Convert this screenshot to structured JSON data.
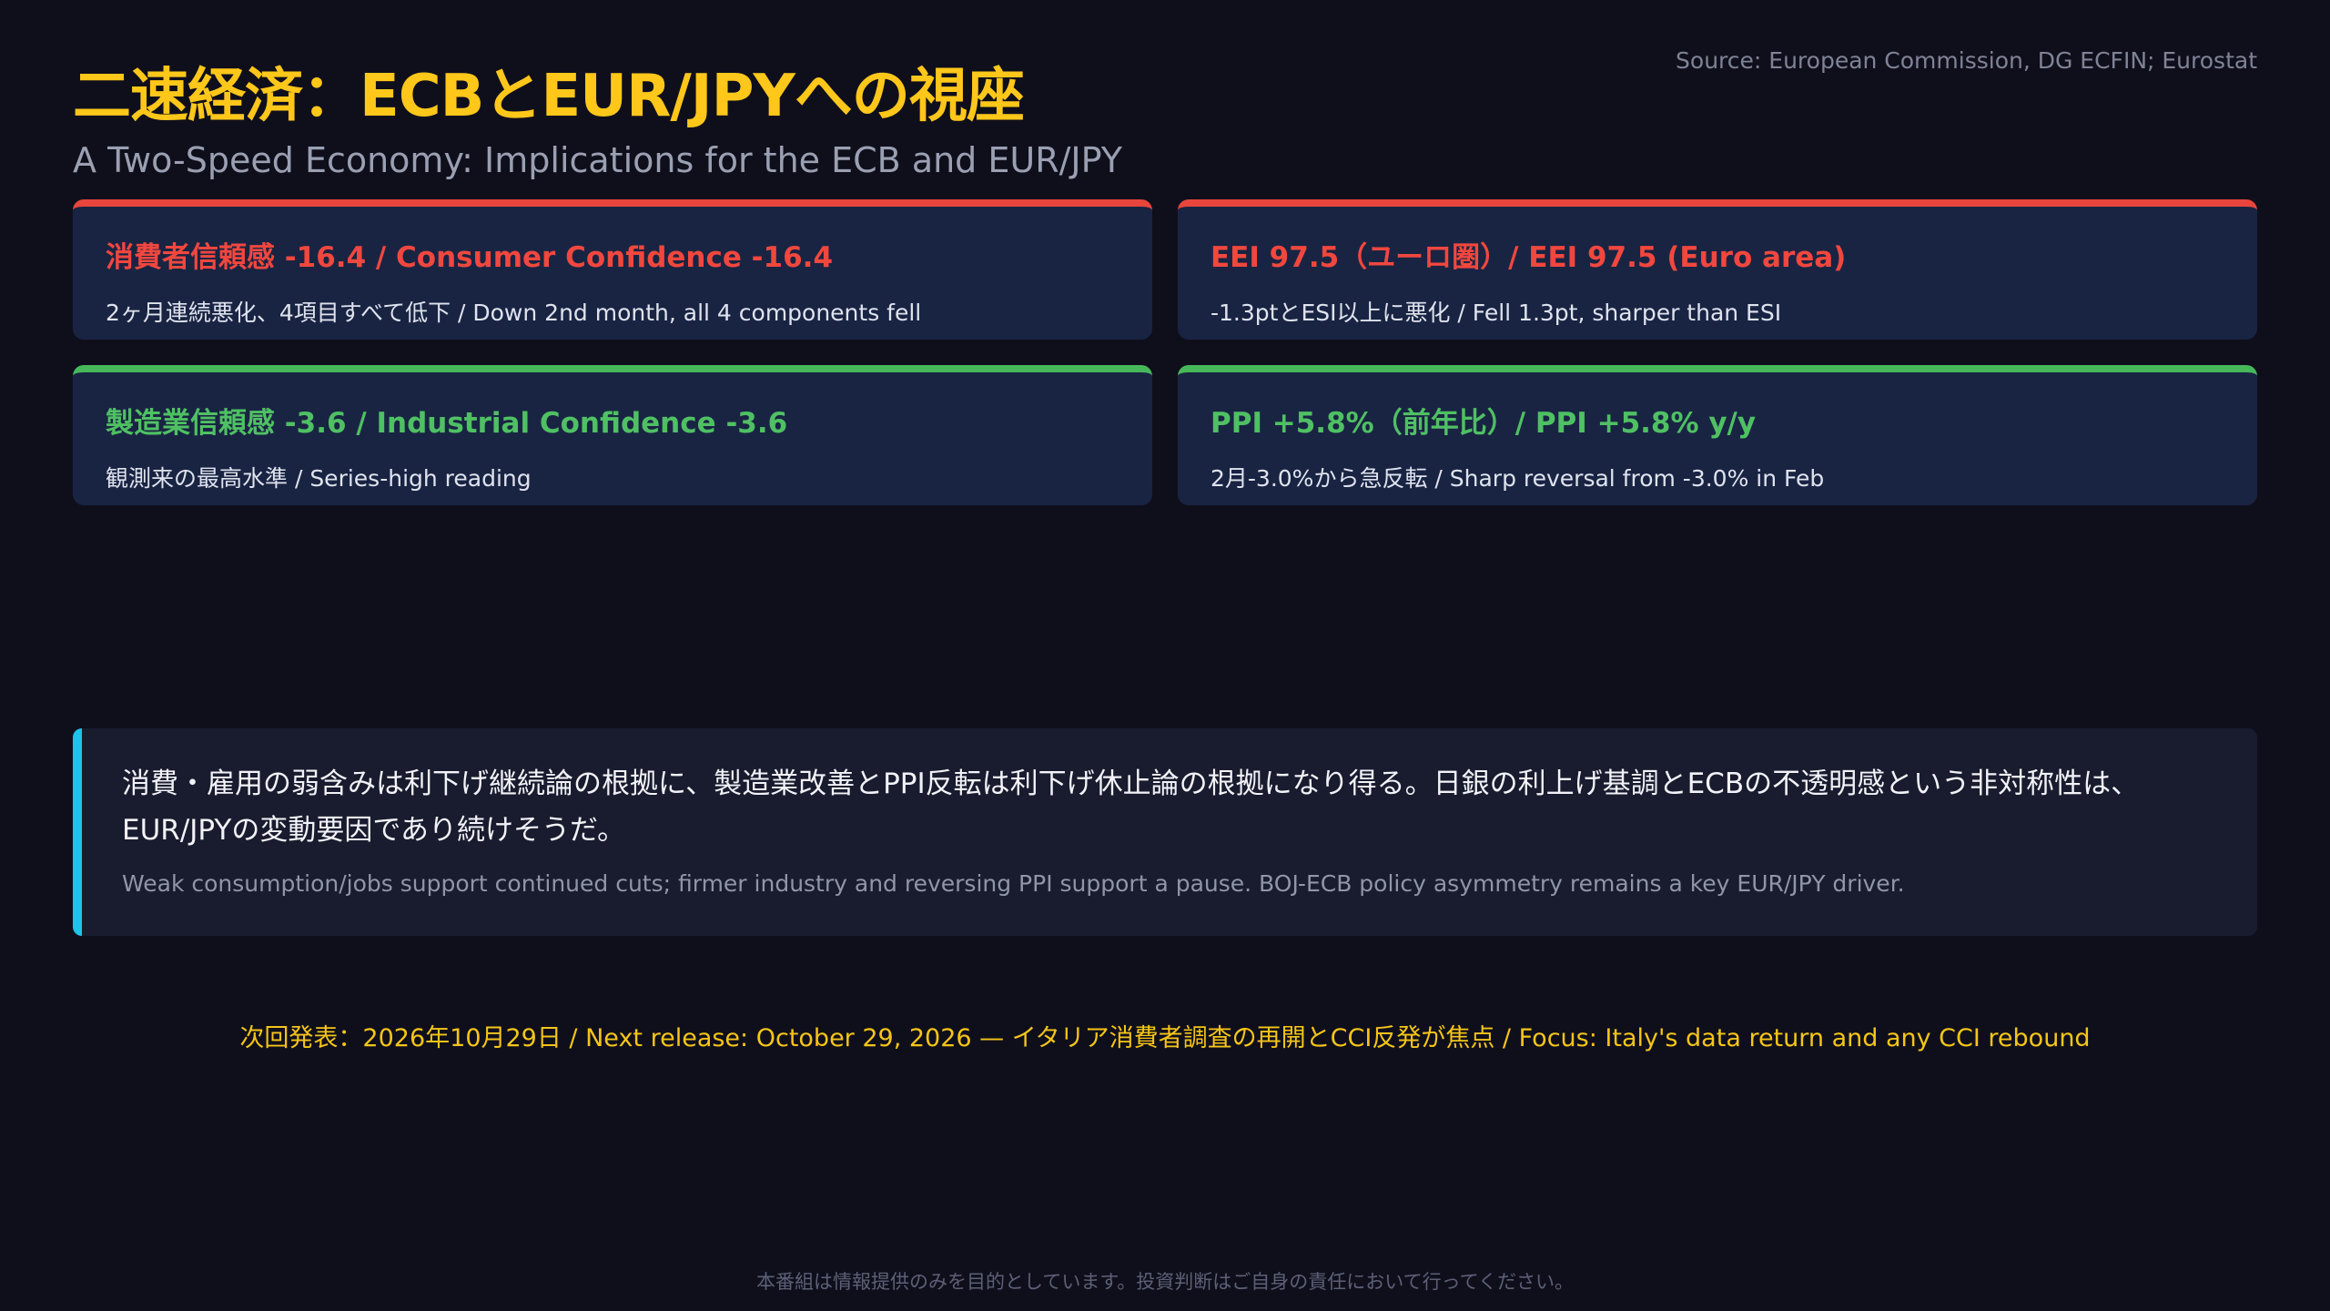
{
  "header": {
    "source": "Source: European Commission, DG ECFIN; Eurostat",
    "title": "二速経済：ECBとEUR/JPYへの視座",
    "subtitle": "A Two-Speed Economy: Implications for the ECB and EUR/JPY"
  },
  "cards": [
    {
      "title": "消費者信頼感 -16.4 / Consumer Confidence -16.4",
      "subtitle": "2ヶ月連続悪化、4項目すべて低下 / Down 2nd month, all 4 components fell",
      "accent": "#e8453c"
    },
    {
      "title": "EEI 97.5（ユーロ圏）/ EEI 97.5 (Euro area)",
      "subtitle": "-1.3ptとESI以上に悪化 / Fell 1.3pt, sharper than ESI",
      "accent": "#e8453c"
    },
    {
      "title": "製造業信頼感 -3.6 / Industrial Confidence -3.6",
      "subtitle": "観測来の最高水準 / Series-high reading",
      "accent": "#47b85a"
    },
    {
      "title": "PPI +5.8%（前年比）/ PPI +5.8% y/y",
      "subtitle": "2月-3.0%から急反転 / Sharp reversal from -3.0% in Feb",
      "accent": "#47b85a"
    }
  ],
  "note": {
    "jp": "消費・雇用の弱含みは利下げ継続論の根拠に、製造業改善とPPI反転は利下げ休止論の根拠になり得る。日銀の利上げ基調とECBの不透明感という非対称性は、EUR/JPYの変動要因であり続けそうだ。",
    "en": "Weak consumption/jobs support continued cuts; firmer industry and reversing PPI support a pause. BOJ-ECB policy asymmetry remains a key EUR/JPY driver.",
    "accent": "#1cc4ea"
  },
  "next_release": "次回発表：2026年10月29日 / Next release: October 29, 2026 — イタリア消費者調査の再開とCCI反発が焦点 / Focus: Italy's data return and any CCI rebound",
  "disclaimer": "本番組は情報提供のみを目的としています。投資判断はご自身の責任において行ってください。",
  "colors": {
    "background": "#0f0f1c",
    "title": "#ffc71a",
    "negative": "#f1473e",
    "positive": "#4fc063"
  }
}
